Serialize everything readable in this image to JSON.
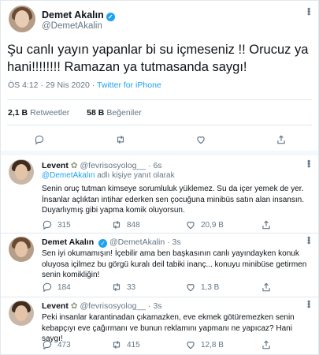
{
  "main_tweet": {
    "name": "Demet Akalın",
    "handle": "@DemetAkalin",
    "text_line1": "Şu canlı yayın yapanlar bi su içmeseniz !! Orucuz ya",
    "text_line2": "hani!!!!!!!! Ramazan ya tutmasanda saygı!",
    "time": "ÖS 4:12 · 29 Nis 2020 ·",
    "source": "Twitter for iPhone",
    "retweets": "2,1 B",
    "retweets_label": "Retweetler",
    "likes": "58 B",
    "likes_label": "Beğeniler"
  },
  "replies": [
    {
      "name": "Levent",
      "handle": "@fevrisosyolog__",
      "time": "· 6s",
      "replying_mention": "@DemetAkalın",
      "replying_suffix": "adlı kişiye yanıt olarak",
      "lines": [
        "Senin oruç tutman kimseye sorumluluk yüklemez. Su da içer yemek de yer.",
        "İnsanlar açlıktan intihar ederken sen çocuğuna minibüs satın alan insansın.",
        "Duyarlıymış gibi yapma komik oluyorsun."
      ],
      "replies": "315",
      "retweets": "848",
      "likes": "20,9 B"
    },
    {
      "name": "Demet Akalın",
      "handle": "@DemetAkalin",
      "time": "· 3s",
      "lines": [
        "Sen iyi okumamışın! İçebilir ama ben başkasının canlı yayındayken konuk",
        "oluyosa içilmez bu görgü kuralı deil tabiki inanç... konuyu minibüse getirmen",
        "senin komikliğin!"
      ],
      "replies": "184",
      "retweets": "33",
      "likes": "1,3 B"
    },
    {
      "name": "Levent",
      "handle": "@fevrisosyolog__",
      "time": "· 3s",
      "lines": [
        "Peki insanlar karantinadan çıkamazken, eve ekmek götüremezken senin",
        "kebapçıyı eve çağırmanı ve bunun reklamını yapmanı ne yapıcaz? Hani saygı!"
      ],
      "replies": "473",
      "retweets": "415",
      "likes": "12,8 B"
    }
  ],
  "colors": {
    "accent": "#1da1f2",
    "muted": "#657786",
    "text": "#0f1419",
    "border": "#e1e8ed"
  },
  "icons": [
    "reply-icon",
    "retweet-icon",
    "like-icon",
    "share-icon",
    "more-icon",
    "verified-badge-icon"
  ]
}
